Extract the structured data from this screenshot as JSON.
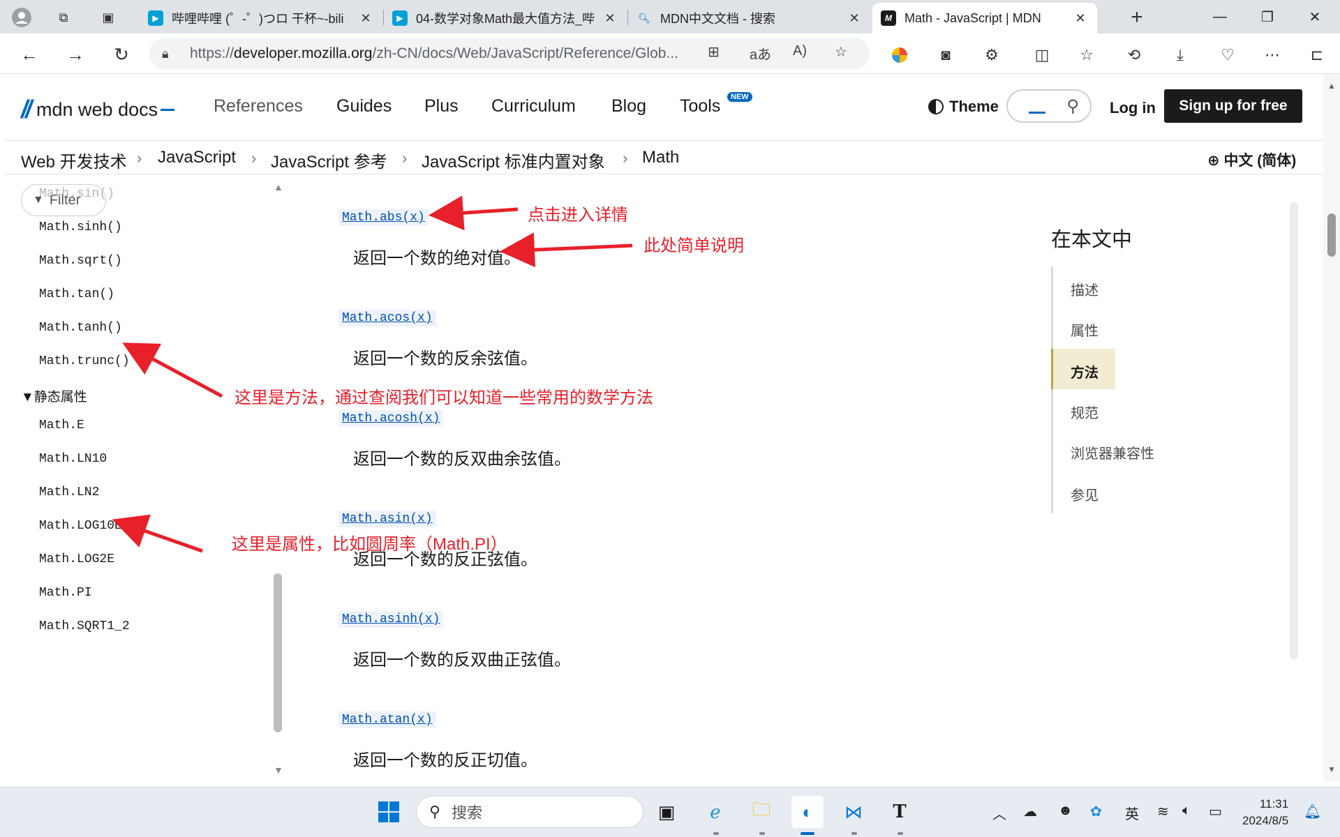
{
  "browser": {
    "tabs": [
      {
        "title": "哔哩哔哩 (゜-゜)つロ 干杯~-bili",
        "favicon": "bilibili-icon"
      },
      {
        "title": "04-数学对象Math最大值方法_哔",
        "favicon": "bilibili-icon"
      },
      {
        "title": "MDN中文文档 - 搜索",
        "favicon": "search-icon"
      },
      {
        "title": "Math - JavaScript | MDN",
        "favicon": "mdn-icon",
        "active": true
      }
    ],
    "url_prefix": "https://",
    "url_domain": "developer.mozilla.org",
    "url_rest": "/zh-CN/docs/Web/JavaScript/Reference/Glob..."
  },
  "mdn": {
    "logo": "mdn web docs",
    "nav": [
      "References",
      "Guides",
      "Plus",
      "Curriculum",
      "Blog",
      "Tools"
    ],
    "tools_badge": "NEW",
    "theme": "Theme",
    "login": "Log in",
    "signup": "Sign up for free",
    "breadcrumb": [
      "Web 开发技术",
      "JavaScript",
      "JavaScript 参考",
      "JavaScript 标准内置对象",
      "Math"
    ],
    "language": "中文 (简体)"
  },
  "sidebar": {
    "filter": "Filter",
    "methods": [
      "Math.sin()",
      "Math.sinh()",
      "Math.sqrt()",
      "Math.tan()",
      "Math.tanh()",
      "Math.trunc()"
    ],
    "group": "▼静态属性",
    "properties": [
      "Math.E",
      "Math.LN10",
      "Math.LN2",
      "Math.LOG10E",
      "Math.LOG2E",
      "Math.PI",
      "Math.SQRT1_2"
    ]
  },
  "main": {
    "entries": [
      {
        "link": "Math.abs(x)",
        "desc": "返回一个数的绝对值。"
      },
      {
        "link": "Math.acos(x)",
        "desc": "返回一个数的反余弦值。"
      },
      {
        "link": "Math.acosh(x)",
        "desc": "返回一个数的反双曲余弦值。"
      },
      {
        "link": "Math.asin(x)",
        "desc": "返回一个数的反正弦值。"
      },
      {
        "link": "Math.asinh(x)",
        "desc": "返回一个数的反双曲正弦值。"
      },
      {
        "link": "Math.atan(x)",
        "desc": "返回一个数的反正切值。"
      }
    ]
  },
  "toc": {
    "title": "在本文中",
    "items": [
      "描述",
      "属性",
      "方法",
      "规范",
      "浏览器兼容性",
      "参见"
    ],
    "active": "方法"
  },
  "annotations": {
    "click_detail": "点击进入详情",
    "short_desc": "此处简单说明",
    "methods_note": "这里是方法，通过查阅我们可以知道一些常用的数学方法",
    "props_note": "这里是属性，比如圆周率（Math.PI）",
    "color": "#e8202a"
  },
  "taskbar": {
    "search": "搜索",
    "ime": "英",
    "time": "11:31",
    "date": "2024/8/5"
  },
  "colors": {
    "mdn_blue": "#0069c2",
    "toc_active_bg": "#f2ecd3"
  }
}
